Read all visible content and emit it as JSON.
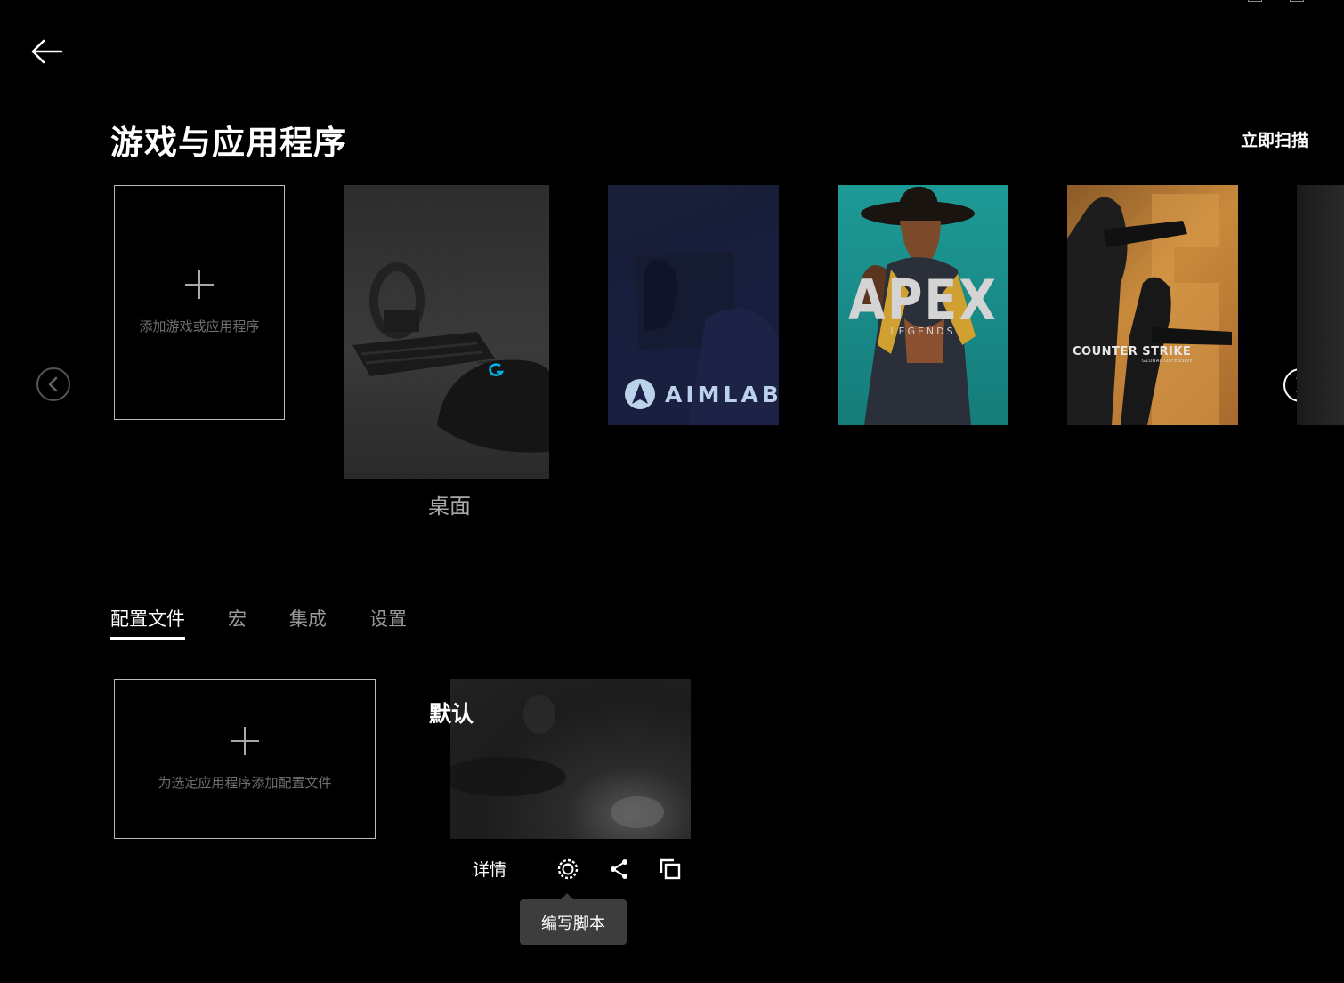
{
  "header": {
    "title": "游戏与应用程序",
    "scan_label": "立即扫描"
  },
  "apps": {
    "add_label": "添加游戏或应用程序",
    "selected_label": "桌面",
    "cards": [
      {
        "name": "桌面",
        "logo": "logitech-g-logo"
      },
      {
        "name": "AIMLAB",
        "logo_text": "AIMLAB"
      },
      {
        "name": "Apex Legends",
        "logo_text": "APEX",
        "logo_sub": "LEGENDS"
      },
      {
        "name": "Counter-Strike: Global Offensive",
        "logo_text": "COUNTER STRIKE",
        "logo_sub": "GLOBAL OFFENSIVE"
      }
    ]
  },
  "tabs": [
    {
      "label": "配置文件",
      "active": true
    },
    {
      "label": "宏",
      "active": false
    },
    {
      "label": "集成",
      "active": false
    },
    {
      "label": "设置",
      "active": false
    }
  ],
  "profiles": {
    "add_label": "为选定应用程序添加配置文件",
    "items": [
      {
        "name": "默认"
      }
    ],
    "details_label": "详情",
    "tooltip": "编写脚本"
  },
  "icons": {
    "back": "arrow-left-icon",
    "prev": "chevron-left-icon",
    "next": "chevron-right-icon",
    "add": "plus-icon",
    "script": "script-gear-icon",
    "share": "share-icon",
    "copy": "copy-icon"
  },
  "colors": {
    "background": "#000000",
    "accent_blue": "#00b4e6",
    "apex_teal": "#1a8a8a"
  }
}
